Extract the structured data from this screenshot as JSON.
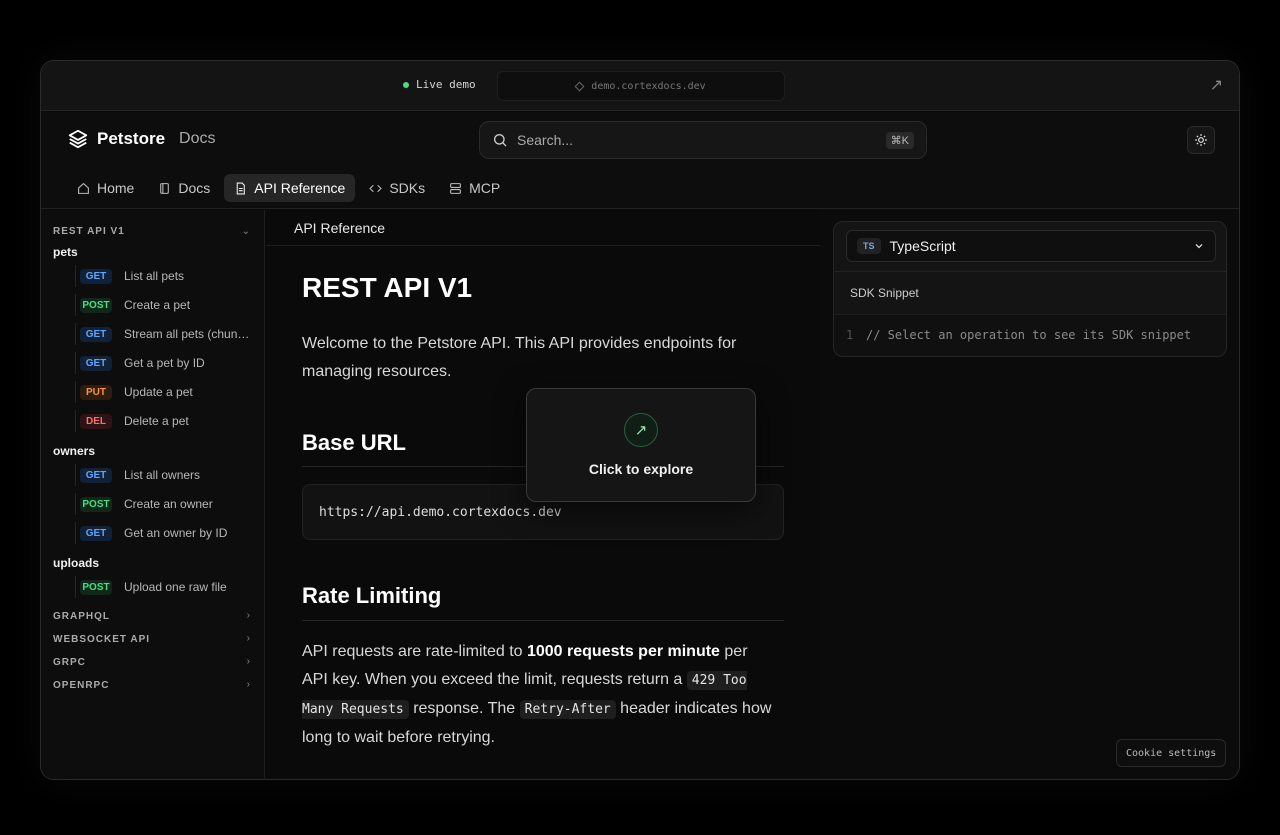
{
  "topbar": {
    "live_label": "Live demo",
    "url": "demo.cortexdocs.dev",
    "external_icon": "arrow-up-right-icon"
  },
  "header": {
    "brand": "Petstore",
    "brand_sub": "Docs",
    "search_placeholder": "Search...",
    "search_shortcut": "⌘K",
    "tabs": [
      {
        "label": "Home",
        "icon": "home-icon"
      },
      {
        "label": "Docs",
        "icon": "book-icon"
      },
      {
        "label": "API Reference",
        "icon": "file-icon",
        "active": true
      },
      {
        "label": "SDKs",
        "icon": "code-icon"
      },
      {
        "label": "MCP",
        "icon": "server-icon"
      }
    ]
  },
  "sidebar": {
    "section": "REST API V1",
    "groups": [
      {
        "title": "pets",
        "endpoints": [
          {
            "method": "GET",
            "label": "List all pets"
          },
          {
            "method": "POST",
            "label": "Create a pet"
          },
          {
            "method": "GET",
            "label": "Stream all pets (chun…"
          },
          {
            "method": "GET",
            "label": "Get a pet by ID"
          },
          {
            "method": "PUT",
            "label": "Update a pet"
          },
          {
            "method": "DEL",
            "label": "Delete a pet"
          }
        ]
      },
      {
        "title": "owners",
        "endpoints": [
          {
            "method": "GET",
            "label": "List all owners"
          },
          {
            "method": "POST",
            "label": "Create an owner"
          },
          {
            "method": "GET",
            "label": "Get an owner by ID"
          }
        ]
      },
      {
        "title": "uploads",
        "endpoints": [
          {
            "method": "POST",
            "label": "Upload one raw file"
          }
        ]
      }
    ],
    "collapsed_sections": [
      "GRAPHQL",
      "WEBSOCKET API",
      "GRPC",
      "OPENRPC"
    ]
  },
  "main": {
    "breadcrumb": "API Reference",
    "title": "REST API V1",
    "intro": "Welcome to the Petstore API. This API provides endpoints for managing resources.",
    "base_url_heading": "Base URL",
    "base_url": "https://api.demo.cortexdocs.dev",
    "rate_heading": "Rate Limiting",
    "rate_p1": "API requests are rate-limited to ",
    "rate_bold": "1000 requests per minute",
    "rate_p2": " per API key. When you exceed the limit, requests return a ",
    "rate_code1": "429 Too Many Requests",
    "rate_p3": " response. The ",
    "rate_code2": "Retry-After",
    "rate_p4": " header indicates how long to wait before retrying."
  },
  "overlay": {
    "label": "Click to explore",
    "icon": "arrow-up-right-icon"
  },
  "sdk": {
    "lang_badge": "TS",
    "lang": "TypeScript",
    "title": "SDK Snippet",
    "line_no": "1",
    "comment": "// Select an operation to see its SDK snippet"
  },
  "cookie_label": "Cookie settings",
  "colors": {
    "live_dot": "#4ade80",
    "get": "#60a5fa",
    "post": "#4ade80",
    "put": "#fb923c",
    "delete": "#f87171"
  }
}
